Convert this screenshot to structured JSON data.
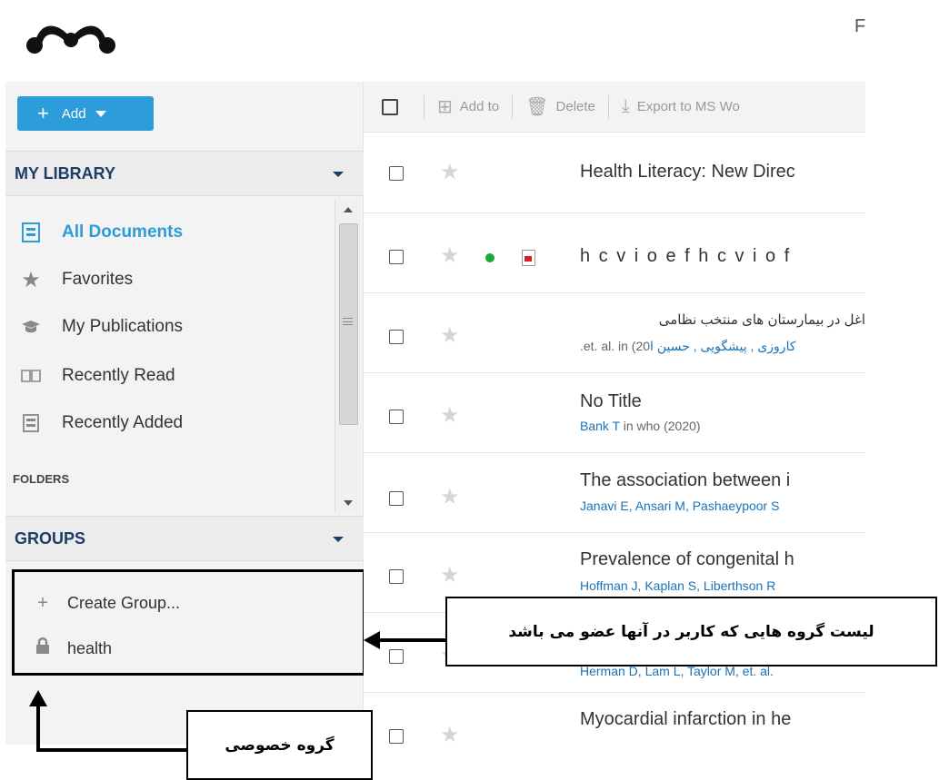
{
  "header": {
    "logo_icon": "mendeley-logo-icon",
    "top_right_char": "F"
  },
  "sidebar": {
    "add_button": "Add",
    "my_library_header": "MY LIBRARY",
    "library_items": [
      {
        "label": "All Documents",
        "icon": "document-icon",
        "active": true
      },
      {
        "label": "Favorites",
        "icon": "star-icon",
        "active": false
      },
      {
        "label": "My Publications",
        "icon": "graduation-cap-icon",
        "active": false
      },
      {
        "label": "Recently Read",
        "icon": "book-icon",
        "active": false
      },
      {
        "label": "Recently Added",
        "icon": "document-icon",
        "active": false
      }
    ],
    "folders_label": "FOLDERS",
    "groups_header": "GROUPS",
    "group_items": [
      {
        "label": "Create Group...",
        "icon": "plus-icon"
      },
      {
        "label": "health",
        "icon": "lock-icon"
      }
    ]
  },
  "toolbar": {
    "add_to": "Add to",
    "delete": "Delete",
    "export": "Export to MS Wo"
  },
  "documents": [
    {
      "title": "Health Literacy: New Direc",
      "authors": "",
      "meta": ""
    },
    {
      "title": "h c v i o e f h c v i o f",
      "authors": "",
      "meta": "",
      "has_dot": true,
      "has_pdf": true
    },
    {
      "title": "اغل در بیمارستان های منتخب نظامی",
      "authors": "کاروزی , پیشگویی , حسین ا",
      "meta": ".et. al. in (20"
    },
    {
      "title": "No Title",
      "authors": "Bank T",
      "meta": " in who (2020)"
    },
    {
      "title": "The association between i",
      "authors": "Janavi E, Ansari M, Pashaeypoor S",
      "meta": ""
    },
    {
      "title": "Prevalence of congenital h",
      "authors": "Hoffman J, Kaplan S, Liberthson R",
      "meta": ""
    },
    {
      "title": "",
      "authors": "Herman D, Lam L, Taylor M, et. al.",
      "meta": ""
    },
    {
      "title": "Myocardial infarction in he",
      "authors": "",
      "meta": ""
    }
  ],
  "annotations": {
    "groups_list_note": "لیست گروه هایی که کاربر در آنها عضو می باشد",
    "private_group_note": "گروه خصوصی"
  },
  "colors": {
    "accent": "#2d9cdb",
    "header_text": "#1c3d66",
    "link": "#1a73b8"
  }
}
